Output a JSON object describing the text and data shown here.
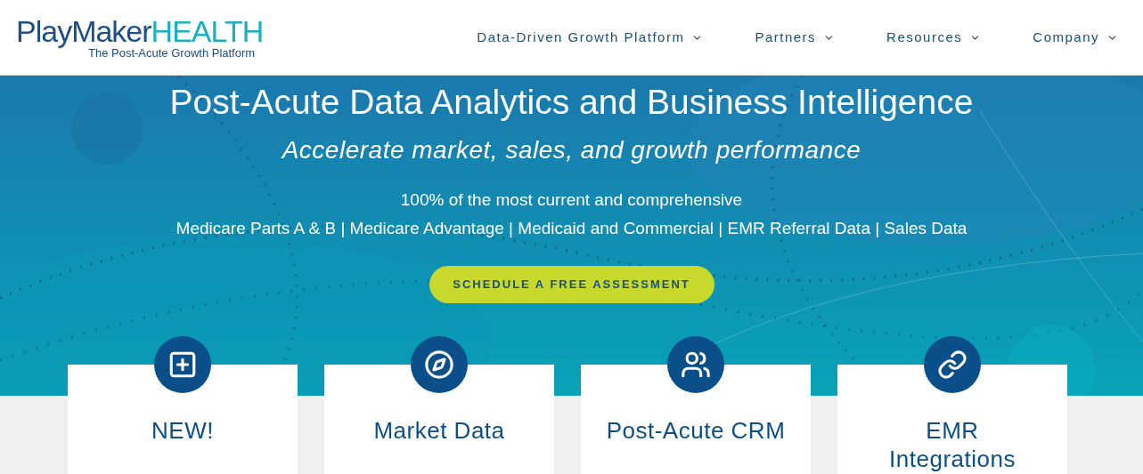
{
  "logo": {
    "name_a": "PlayMaker",
    "name_b": "HEALTH",
    "tagline": "The Post-Acute Growth Platform"
  },
  "nav": [
    {
      "label": "Data-Driven Growth Platform"
    },
    {
      "label": "Partners"
    },
    {
      "label": "Resources"
    },
    {
      "label": "Company"
    }
  ],
  "hero": {
    "title": "Post-Acute Data Analytics and Business Intelligence",
    "subtitle": "Accelerate market, sales, and growth performance",
    "line_1": "100% of the most current and comprehensive",
    "line_2": "Medicare Parts A & B | Medicare Advantage | Medicaid and Commercial | EMR Referral Data | Sales Data",
    "button": "SCHEDULE A FREE ASSESSMENT"
  },
  "cards": [
    {
      "kind": "plus",
      "title_lines": [
        "NEW!"
      ]
    },
    {
      "kind": "compass",
      "title_lines": [
        "Market Data"
      ]
    },
    {
      "kind": "people",
      "title_lines": [
        "Post-Acute CRM"
      ]
    },
    {
      "kind": "link",
      "title_lines": [
        "EMR",
        "Integrations"
      ]
    }
  ]
}
